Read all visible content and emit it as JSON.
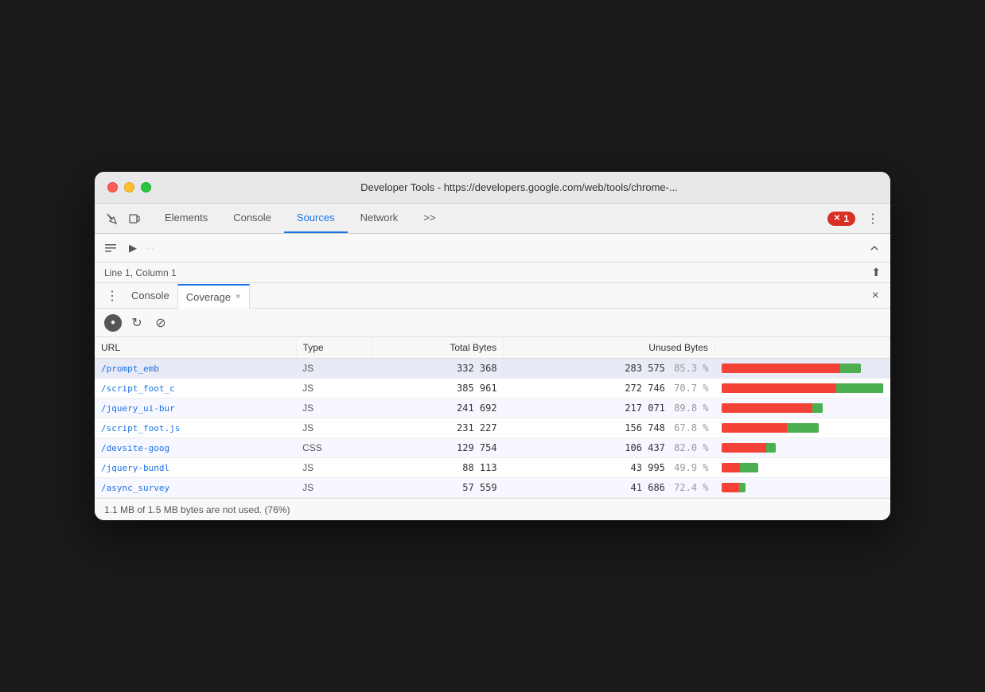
{
  "window": {
    "title": "Developer Tools - https://developers.google.com/web/tools/chrome-..."
  },
  "tabs": {
    "list": [
      "Elements",
      "Console",
      "Sources",
      "Network",
      ">>"
    ],
    "active": "Sources"
  },
  "right_buttons": {
    "error_count": "1",
    "more_icon": "⋮"
  },
  "sub_toolbar": {
    "resume_icon": "▶",
    "location_text": ""
  },
  "line_info": {
    "text": "Line 1, Column 1"
  },
  "panel": {
    "dots": "⋮",
    "tabs": [
      {
        "label": "Console",
        "active": false,
        "closable": false
      },
      {
        "label": "Coverage",
        "active": true,
        "closable": true
      }
    ],
    "close_label": "×"
  },
  "coverage_toolbar": {
    "record_btn": "●",
    "refresh_btn": "↻",
    "clear_btn": "⊘"
  },
  "table": {
    "headers": [
      "URL",
      "Type",
      "Total Bytes",
      "Unused Bytes",
      ""
    ],
    "rows": [
      {
        "url": "/prompt_emb",
        "type": "JS",
        "total_bytes": "332 368",
        "unused_bytes": "283 575",
        "unused_pct": "85.3 %",
        "used_pct": 14.7,
        "unused_bar_pct": 85.3
      },
      {
        "url": "/script_foot_c",
        "type": "JS",
        "total_bytes": "385 961",
        "unused_bytes": "272 746",
        "unused_pct": "70.7 %",
        "used_pct": 29.3,
        "unused_bar_pct": 70.7
      },
      {
        "url": "/jquery_ui-bur",
        "type": "JS",
        "total_bytes": "241 692",
        "unused_bytes": "217 071",
        "unused_pct": "89.8 %",
        "used_pct": 10.2,
        "unused_bar_pct": 89.8
      },
      {
        "url": "/script_foot.js",
        "type": "JS",
        "total_bytes": "231 227",
        "unused_bytes": "156 748",
        "unused_pct": "67.8 %",
        "used_pct": 32.2,
        "unused_bar_pct": 67.8
      },
      {
        "url": "/devsite-goog",
        "type": "CSS",
        "total_bytes": "129 754",
        "unused_bytes": "106 437",
        "unused_pct": "82.0 %",
        "used_pct": 18.0,
        "unused_bar_pct": 82.0
      },
      {
        "url": "/jquery-bundl",
        "type": "JS",
        "total_bytes": "88 113",
        "unused_bytes": "43 995",
        "unused_pct": "49.9 %",
        "used_pct": 50.1,
        "unused_bar_pct": 49.9
      },
      {
        "url": "/async_survey",
        "type": "JS",
        "total_bytes": "57 559",
        "unused_bytes": "41 686",
        "unused_pct": "72.4 %",
        "used_pct": 27.6,
        "unused_bar_pct": 72.4
      }
    ]
  },
  "footer": {
    "text": "1.1 MB of 1.5 MB bytes are not used. (76%)"
  }
}
